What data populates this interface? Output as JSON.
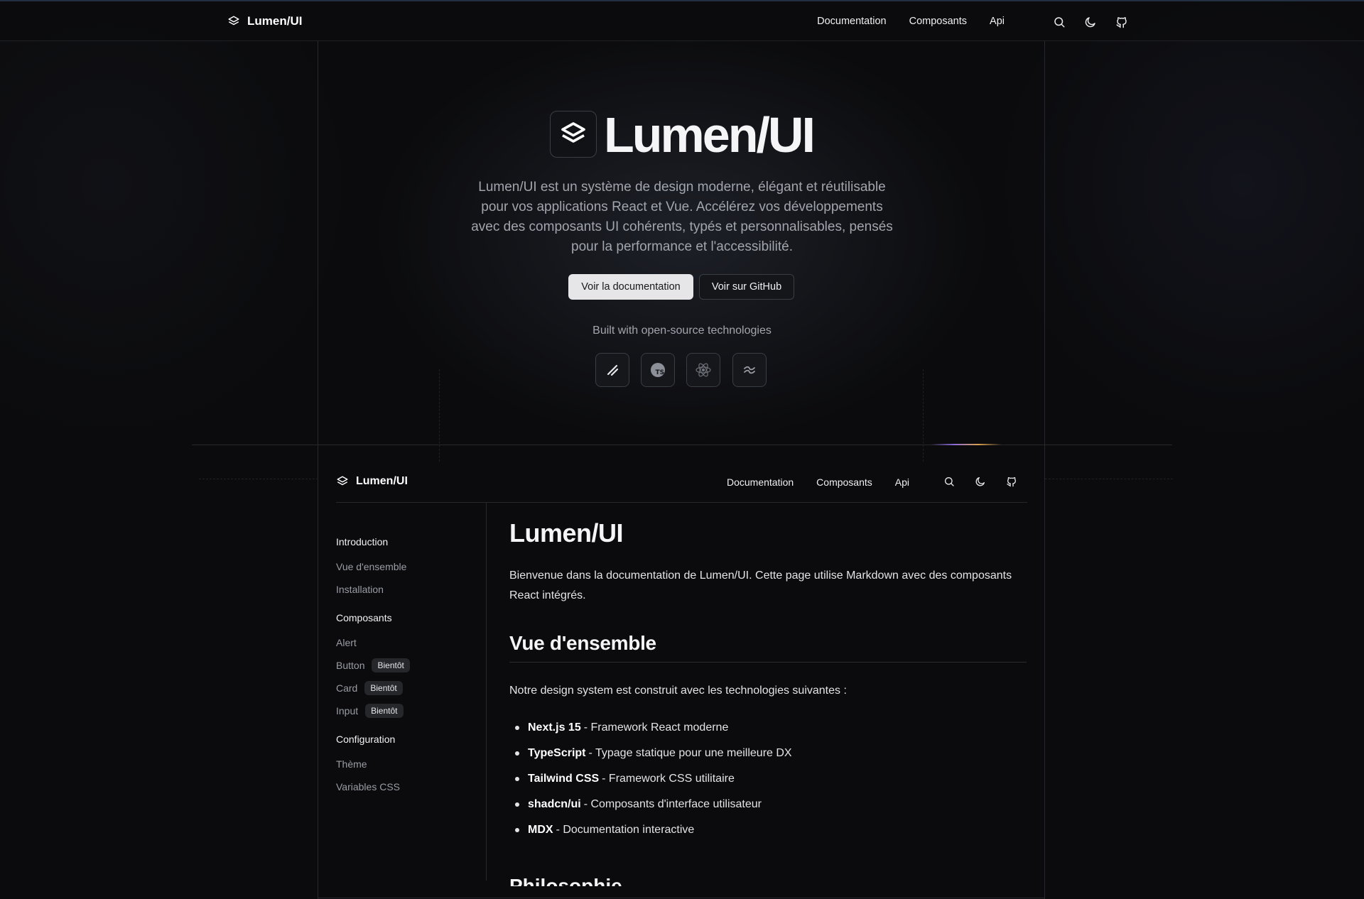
{
  "header": {
    "brand": "Lumen/UI",
    "nav": [
      "Documentation",
      "Composants",
      "Api"
    ],
    "icons": [
      "search-icon",
      "moon-icon",
      "github-icon"
    ]
  },
  "hero": {
    "title": "Lumen/UI",
    "description": "Lumen/UI est un système de design moderne, élégant et réutilisable pour vos applications React et Vue. Accélérez vos développements avec des composants UI cohérents, typés et personnalisables, pensés pour la performance et l'accessibilité.",
    "primary_button": "Voir la documentation",
    "secondary_button": "Voir sur GitHub",
    "built_with": "Built with open-source technologies",
    "tech_icons": [
      "nextjs-icon",
      "typescript-icon",
      "react-icon",
      "tailwind-icon"
    ]
  },
  "preview": {
    "brand": "Lumen/UI",
    "nav": [
      "Documentation",
      "Composants",
      "Api"
    ],
    "sidebar": {
      "groups": [
        {
          "title": "Introduction",
          "items": [
            {
              "label": "Vue d'ensemble",
              "badge": ""
            },
            {
              "label": "Installation",
              "badge": ""
            }
          ]
        },
        {
          "title": "Composants",
          "items": [
            {
              "label": "Alert",
              "badge": ""
            },
            {
              "label": "Button",
              "badge": "Bientôt"
            },
            {
              "label": "Card",
              "badge": "Bientôt"
            },
            {
              "label": "Input",
              "badge": "Bientôt"
            }
          ]
        },
        {
          "title": "Configuration",
          "items": [
            {
              "label": "Thème",
              "badge": ""
            },
            {
              "label": "Variables CSS",
              "badge": ""
            }
          ]
        }
      ]
    },
    "content": {
      "title": "Lumen/UI",
      "intro": "Bienvenue dans la documentation de Lumen/UI. Cette page utilise Markdown avec des composants React intégrés.",
      "section_title": "Vue d'ensemble",
      "lead": "Notre design system est construit avec les technologies suivantes :",
      "list": [
        {
          "name": "Next.js 15",
          "desc": "- Framework React moderne"
        },
        {
          "name": "TypeScript",
          "desc": "- Typage statique pour une meilleure DX"
        },
        {
          "name": "Tailwind CSS",
          "desc": "- Framework CSS utilitaire"
        },
        {
          "name": "shadcn/ui",
          "desc": "- Composants d'interface utilisateur"
        },
        {
          "name": "MDX",
          "desc": "- Documentation interactive"
        }
      ],
      "next_section": "Philosophie"
    }
  },
  "colors": {
    "background": "#0b0b0d",
    "text": "#e8e8ea",
    "muted": "#a2a5ad",
    "border": "#26282d"
  }
}
